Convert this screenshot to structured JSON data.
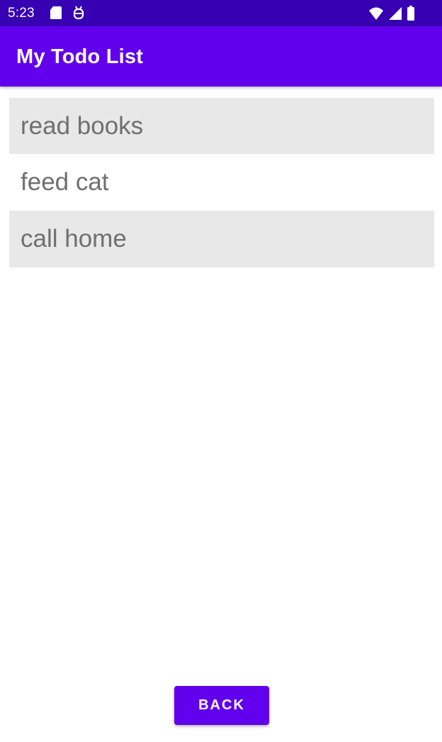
{
  "status_bar": {
    "time": "5:23",
    "left_icons": [
      "sd-card-icon",
      "debug-icon"
    ],
    "right_icons": [
      "wifi-icon",
      "signal-icon",
      "battery-icon"
    ],
    "color": "#3700b3"
  },
  "app_bar": {
    "title": "My Todo List",
    "color": "#6200ee"
  },
  "todos": [
    {
      "label": "read books"
    },
    {
      "label": "feed cat"
    },
    {
      "label": "call home"
    }
  ],
  "actions": {
    "back_label": "BACK"
  },
  "colors": {
    "accent": "#6200ee",
    "row_shade": "#e8e8e8",
    "item_text": "#6f6f6f"
  }
}
